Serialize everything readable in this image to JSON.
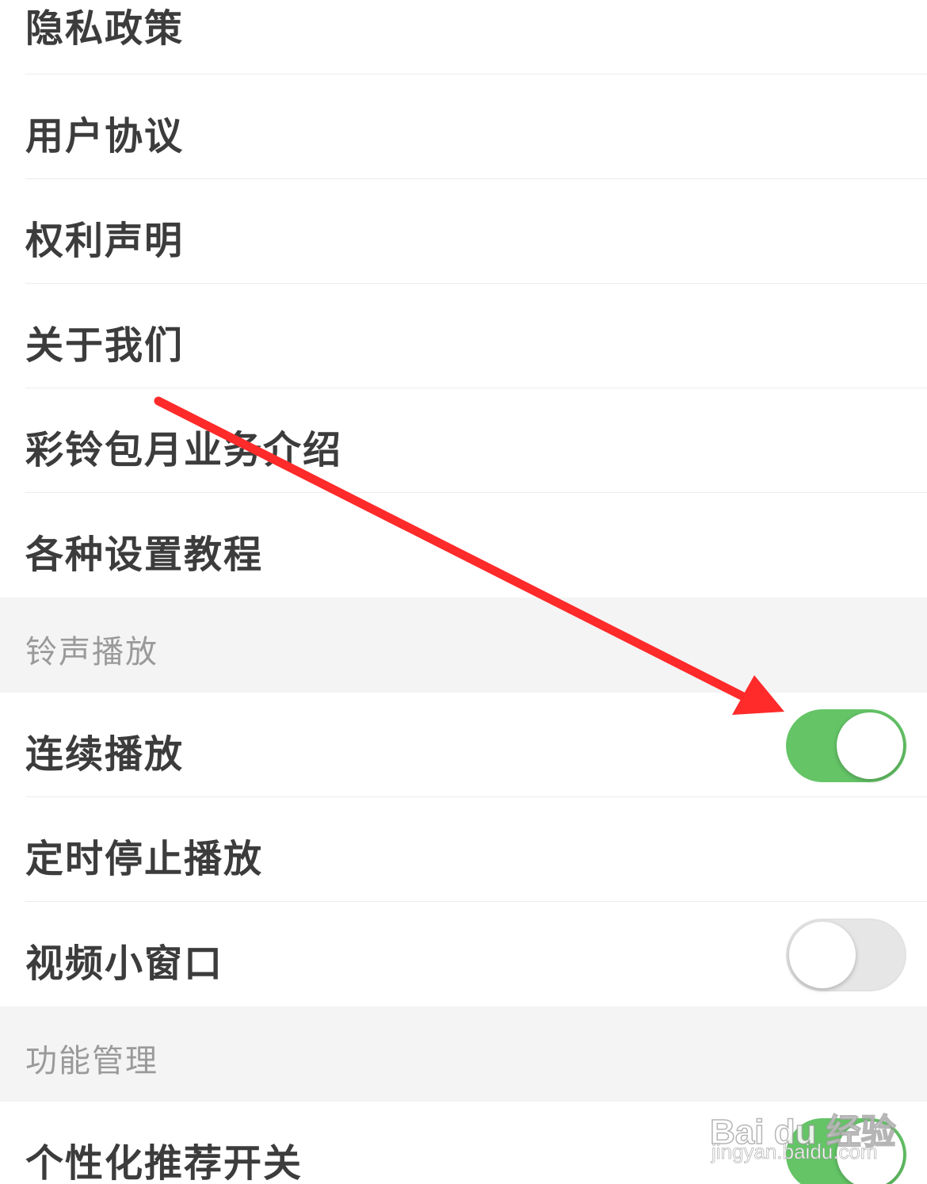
{
  "menu_items": [
    {
      "label": "隐私政策"
    },
    {
      "label": "用户协议"
    },
    {
      "label": "权利声明"
    },
    {
      "label": "关于我们"
    },
    {
      "label": "彩铃包月业务介绍"
    },
    {
      "label": "各种设置教程"
    }
  ],
  "sections": {
    "playback": {
      "title": "铃声播放",
      "items": [
        {
          "label": "连续播放",
          "toggle": "on"
        },
        {
          "label": "定时停止播放"
        },
        {
          "label": "视频小窗口",
          "toggle": "off"
        }
      ]
    },
    "features": {
      "title": "功能管理",
      "items": [
        {
          "label": "个性化推荐开关",
          "toggle": "on"
        }
      ]
    }
  },
  "watermark": {
    "brand": "Bai du 经验",
    "url": "jingyan.baidu.com"
  },
  "colors": {
    "toggle_on": "#64c466",
    "toggle_off": "#e6e6e6",
    "section_bg": "#f4f4f4",
    "annotation_arrow": "#ff2a2a"
  }
}
